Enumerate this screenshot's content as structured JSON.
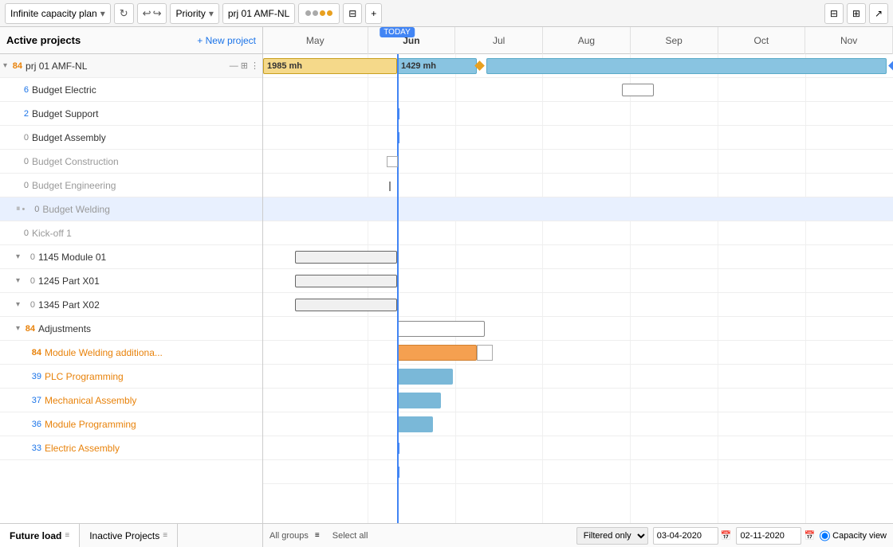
{
  "toolbar": {
    "plan_label": "Infinite capacity plan",
    "priority_label": "Priority",
    "project_label": "prj 01 AMF-NL",
    "add_label": "+",
    "refresh_icon": "↻",
    "undo_icon": "↩",
    "redo_icon": "↪"
  },
  "panel": {
    "title": "Active projects",
    "new_project": "+ New project"
  },
  "months": [
    "May",
    "Jun",
    "Jul",
    "Aug",
    "Sep",
    "Oct",
    "Nov"
  ],
  "today_label": "TODAY",
  "rows": [
    {
      "id": "prj01",
      "num": "84",
      "num_style": "orange",
      "label": "prj 01 AMF-NL",
      "label_style": "normal",
      "level": 0,
      "collapsed": false,
      "has_actions": true
    },
    {
      "id": "budget_elec",
      "num": "6",
      "num_style": "blue",
      "label": "Budget Electric",
      "label_style": "normal",
      "level": 1
    },
    {
      "id": "budget_sup",
      "num": "2",
      "num_style": "blue",
      "label": "Budget Support",
      "label_style": "normal",
      "level": 1
    },
    {
      "id": "budget_asm",
      "num": "0",
      "num_style": "gray",
      "label": "Budget Assembly",
      "label_style": "normal",
      "level": 1
    },
    {
      "id": "budget_con",
      "num": "0",
      "num_style": "gray",
      "label": "Budget Construction",
      "label_style": "gray",
      "level": 1
    },
    {
      "id": "budget_eng",
      "num": "0",
      "num_style": "gray",
      "label": "Budget Engineering",
      "label_style": "gray",
      "level": 1
    },
    {
      "id": "budget_wel",
      "num": "0",
      "num_style": "gray",
      "label": "Budget Welding",
      "label_style": "gray",
      "level": 1,
      "highlighted": true
    },
    {
      "id": "kickoff",
      "num": "0",
      "num_style": "gray",
      "label": "Kick-off 1",
      "label_style": "gray",
      "level": 1
    },
    {
      "id": "mod01",
      "num": "0",
      "num_style": "gray",
      "label": "1145 Module 01",
      "label_style": "normal",
      "level": 1,
      "collapsible": true
    },
    {
      "id": "partx01",
      "num": "0",
      "num_style": "gray",
      "label": "1245 Part X01",
      "label_style": "normal",
      "level": 1,
      "collapsible": true
    },
    {
      "id": "partx02",
      "num": "0",
      "num_style": "gray",
      "label": "1345 Part X02",
      "label_style": "normal",
      "level": 1,
      "collapsible": true
    },
    {
      "id": "adjustments",
      "num": "84",
      "num_style": "orange",
      "label": "Adjustments",
      "label_style": "normal",
      "level": 1,
      "collapsible": true
    },
    {
      "id": "mod_weld",
      "num": "84",
      "num_style": "orange",
      "label": "Module Welding additiona...",
      "label_style": "orange",
      "level": 2
    },
    {
      "id": "plc",
      "num": "39",
      "num_style": "blue",
      "label": "PLC Programming",
      "label_style": "orange",
      "level": 2
    },
    {
      "id": "mech_asm",
      "num": "37",
      "num_style": "blue",
      "label": "Mechanical Assembly",
      "label_style": "orange",
      "level": 2
    },
    {
      "id": "mod_prog",
      "num": "36",
      "num_style": "blue",
      "label": "Module Programming",
      "label_style": "orange",
      "level": 2
    },
    {
      "id": "elec_asm",
      "num": "33",
      "num_style": "blue",
      "label": "Electric Assembly",
      "label_style": "orange",
      "level": 2
    }
  ],
  "bottom_tabs": [
    {
      "id": "future_load",
      "label": "Future load"
    },
    {
      "id": "inactive",
      "label": "Inactive Projects"
    }
  ],
  "bottom_bar": {
    "filter_label": "Filtered only",
    "date_from": "03-04-2020",
    "date_to": "02-11-2020",
    "view_label": "Capacity view",
    "all_groups": "All groups",
    "select_all": "Select all"
  }
}
